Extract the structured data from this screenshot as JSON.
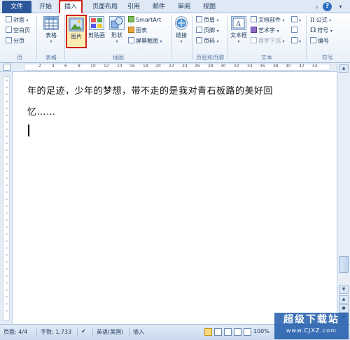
{
  "tabs": [
    "文件",
    "开始",
    "插入",
    "页面布局",
    "引用",
    "邮件",
    "审阅",
    "视图"
  ],
  "active_tab": "插入",
  "ribbon": {
    "pages": {
      "label": "页",
      "items": [
        "封面",
        "空白页",
        "分页"
      ]
    },
    "tables": {
      "label": "表格",
      "button": "表格"
    },
    "illustrations": {
      "label": "插图",
      "picture": "图片",
      "clipart": "剪贴画",
      "shapes": "形状",
      "smartart": "SmartArt",
      "chart": "图表",
      "screenshot": "屏幕截图"
    },
    "links": {
      "label": "",
      "button": "链接"
    },
    "header_footer": {
      "label": "页眉和页脚",
      "items": [
        "页眉",
        "页脚",
        "页码"
      ]
    },
    "text": {
      "label": "文本",
      "textbox": "文本框",
      "items": [
        "文档部件",
        "艺术字",
        "首字下沉"
      ]
    },
    "symbols": {
      "label": "符号",
      "items": [
        "公式",
        "符号",
        "编号"
      ]
    }
  },
  "ruler_ticks": [
    "2",
    "4",
    "6",
    "8",
    "10",
    "12",
    "14",
    "16",
    "18",
    "20",
    "22",
    "24",
    "26",
    "28",
    "30",
    "32",
    "34",
    "36",
    "38",
    "40",
    "42",
    "44"
  ],
  "document": {
    "line1": "年的足迹，少年的梦想，带不走的是我对青石板路的美好回",
    "line2": "忆……"
  },
  "status": {
    "page": "页面: 4/4",
    "words": "字数: 1,733",
    "language": "英语(美国)",
    "mode": "插入",
    "zoom": "100%"
  },
  "watermark": {
    "line1": "超级下载站",
    "line2": "www.CJXZ.com"
  },
  "colors": {
    "file_tab": "#2b579a",
    "highlight": "#d0201a",
    "ribbon_bg": "#e9f0f9"
  }
}
